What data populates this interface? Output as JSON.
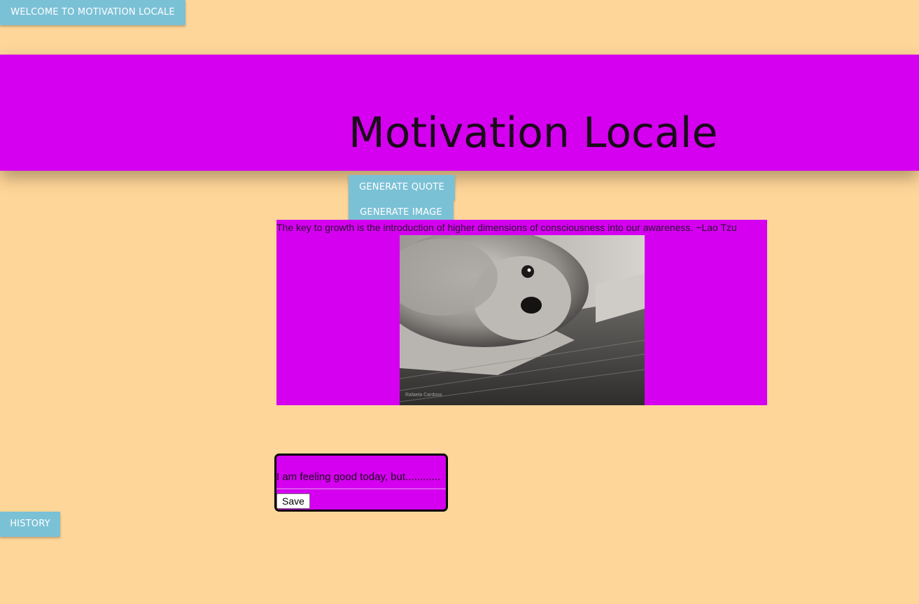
{
  "nav": {
    "welcome_label": "WELCOME TO MOTIVATION LOCALE",
    "history_label": "HISTORY"
  },
  "header": {
    "title": "Motivation Locale",
    "generate_quote_label": "GENERATE QUOTE",
    "generate_image_label": "GENERATE IMAGE"
  },
  "quote": {
    "text": "The key to growth is the introduction of higher dimensions of consciousness into our awareness. ~Lao Tzu",
    "image_watermark": "Rafaela Cardoso"
  },
  "journal": {
    "placeholder": "I am feeling good today, but............",
    "save_label": "Save"
  },
  "colors": {
    "background": "#ffd699",
    "accent_magenta": "#d400ef",
    "button_blue": "#7bc1d6"
  }
}
